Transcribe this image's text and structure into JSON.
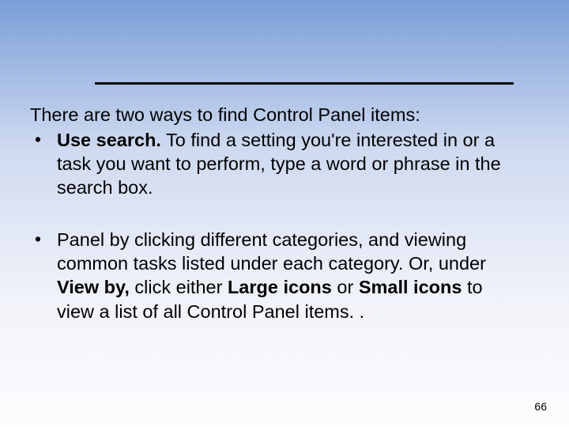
{
  "intro": "There are two ways to find Control Panel items:",
  "bullets": [
    {
      "lead_bold": "Use search.",
      "rest": " To find a setting you're interested in or a task you want to perform, type a word or phrase in the search box."
    },
    {
      "pre": "Panel by clicking different categories, and viewing common tasks listed under each category. Or, under ",
      "b1": "View by,",
      "mid1": " click either ",
      "b2": "Large icons",
      "mid2": " or ",
      "b3": "Small icons",
      "post": " to view a list of all Control Panel items. ."
    }
  ],
  "page_number": "66"
}
